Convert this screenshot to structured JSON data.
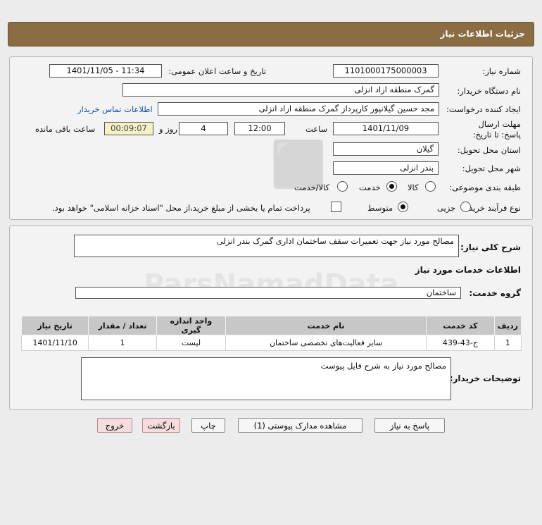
{
  "header": {
    "title": "جزئیات اطلاعات نیاز"
  },
  "form": {
    "need_number_label": "شماره نیاز:",
    "need_number": "1101000175000003",
    "announce_label": "تاریخ و ساعت اعلان عمومی:",
    "announce_value": "1401/11/05 - 11:34",
    "buyer_org_label": "نام دستگاه خریدار:",
    "buyer_org": "گمرک منطقه ازاد انزلی",
    "creator_label": "ایجاد کننده درخواست:",
    "creator": "مجد حسین گیلانپور کارپرداز گمرک منطقه ازاد انزلی",
    "contact_link": "اطلاعات تماس خریدار",
    "deadline_label": "مهلت ارسال پاسخ: تا تاریخ:",
    "deadline_date": "1401/11/09",
    "time_label": "ساعت",
    "deadline_time": "12:00",
    "days_value": "4",
    "days_label": "روز و",
    "remaining_time": "00:09:07",
    "remaining_label": "ساعت باقی مانده",
    "province_label": "استان محل تحویل:",
    "province": "گیلان",
    "city_label": "شهر محل تحویل:",
    "city": "بندر انزلی",
    "category_label": "طبقه بندی موضوعی:",
    "category_options": [
      "کالا",
      "خدمت",
      "کالا/خدمت"
    ],
    "category_selected": "خدمت",
    "process_label": "نوع فرآیند خرید :",
    "process_options": [
      "جزیی",
      "متوسط"
    ],
    "process_selected": "متوسط",
    "payment_note": "پرداخت تمام یا بخشی از مبلغ خرید،از محل \"اسناد خزانه اسلامی\" خواهد بود."
  },
  "details": {
    "summary_label": "شرح کلی نیاز:",
    "summary": "مصالح مورد نیاز جهت تعمیرات سقف ساختمان اداری گمرک بندر انزلی",
    "services_title": "اطلاعات خدمات مورد نیاز",
    "service_group_label": "گروه خدمت:",
    "service_group": "ساختمان",
    "table": {
      "headers": [
        "ردیف",
        "کد خدمت",
        "نام خدمت",
        "واحد اندازه گیری",
        "تعداد / مقدار",
        "تاریخ نیاز"
      ],
      "rows": [
        [
          "1",
          "ج-43-439",
          "سایر فعالیت‌های تخصصی ساختمان",
          "لیست",
          "1",
          "1401/11/10"
        ]
      ]
    },
    "buyer_notes_label": "توضیحات خریدار:",
    "buyer_notes": "مصالح مورد نیاز به شرح فایل پیوست"
  },
  "buttons": {
    "reply": "پاسخ به نیاز",
    "attachments": "مشاهده مدارک پیوستی (1)",
    "print": "چاپ",
    "back": "بازگشت",
    "exit": "خروج"
  },
  "colors": {
    "header_bg": "#8b6d43",
    "link": "#1a4fa3",
    "remaining_bg": "#f4f1c5"
  }
}
